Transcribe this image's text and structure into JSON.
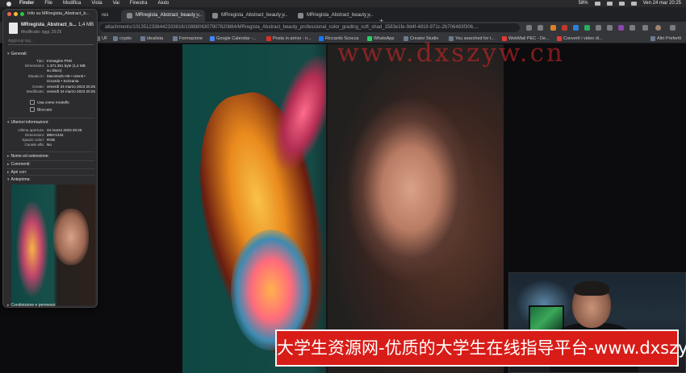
{
  "menubar": {
    "items": [
      "Finder",
      "File",
      "Modifica",
      "Vista",
      "Vai",
      "Finestra",
      "Aiuto"
    ],
    "battery": "58%",
    "clock": "Ven 24 mar  20:25"
  },
  "browser": {
    "tabs": [
      {
        "label": "Info su MRregista_Abstract..."
      },
      {
        "label": "res"
      },
      {
        "label": "MRregista_Abstract_beauty_..."
      },
      {
        "label": "MRregista_Abstract_beauty_..."
      },
      {
        "label": "MRregista_Abstract_beauty_..."
      }
    ],
    "new_tab": "+",
    "url": "attachments/1013512336442333816/1088806307907820884/MRregista_Abstract_beauty_professional_color_grading_soft_shad_1583e1fe-9d4f-4819-971c-2b706483f306....",
    "bookmarks": [
      {
        "label": "UF",
        "color": "#8a8a8a"
      },
      {
        "label": "crypto",
        "color": "#6b7a8f"
      },
      {
        "label": "idealista",
        "color": "#6b7a8f"
      },
      {
        "label": "Formazione",
        "color": "#6b7a8f"
      },
      {
        "label": "Google Calendar -...",
        "color": "#4285f4"
      },
      {
        "label": "Posta in arrivo - n...",
        "color": "#d93025"
      },
      {
        "label": "Riccardo Scocca",
        "color": "#1877f2"
      },
      {
        "label": "WhatsApp",
        "color": "#25d366"
      },
      {
        "label": "Creator Studio",
        "color": "#6b7a8f"
      },
      {
        "label": "You searched for t...",
        "color": "#6b7a8f"
      },
      {
        "label": "WebMail PEC - De...",
        "color": "#e53935"
      },
      {
        "label": "Convertì i video di...",
        "color": "#e53935"
      },
      {
        "label": "Altri Preferiti",
        "color": "#6b7a8f"
      }
    ]
  },
  "info_window": {
    "title": "Info su MRregista_Abstract_b...",
    "file_name": "MRregista_Abstract_b...",
    "file_size": "1,4 MB",
    "modified_short": "Modificato: oggi, 20:25",
    "tags_placeholder": "Aggiungi tag...",
    "general_header": "Generali:",
    "general": [
      {
        "k": "Tipo:",
        "v": "Immagine PNG"
      },
      {
        "k": "Dimensioni:",
        "v": "1.371.351 byte (1,4 MB"
      },
      {
        "k": "",
        "v": "su disco)"
      },
      {
        "k": "Situato in:",
        "v": "Macintosh HD • Utenti •"
      },
      {
        "k": "",
        "v": "riccardo • Scrivania"
      },
      {
        "k": "Creato:",
        "v": "venerdì 24 marzo 2023 20:25"
      },
      {
        "k": "Modificato:",
        "v": "venerdì 24 marzo 2023 20:25"
      }
    ],
    "check_template": "Usa come modello",
    "check_locked": "Bloccato",
    "more_header": "Ulteriori informazioni:",
    "more": [
      {
        "k": "Ultima apertura:",
        "v": "24 marzo 2023 20:25"
      },
      {
        "k": "Dimensioni:",
        "v": "896×1344"
      },
      {
        "k": "Spazio colori:",
        "v": "RGB"
      },
      {
        "k": "Canale alfa:",
        "v": "No"
      }
    ],
    "sections": [
      "Nome ed estensione:",
      "Commenti:",
      "Apri con:"
    ],
    "preview_header": "Anteprima:",
    "sharing_header": "Condivisione e permessi:"
  },
  "watermark": {
    "url": "www.dxszyw.cn",
    "banner": "大学生资源网-优质的大学生在线指导平台-www.dxszyw.cn"
  }
}
